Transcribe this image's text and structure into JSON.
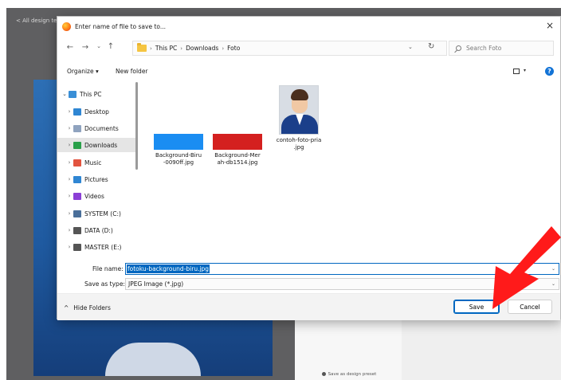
{
  "background": {
    "back_link": "< All design te",
    "preset_label": "Save as design preset"
  },
  "dialog": {
    "title": "Enter name of file to save to...",
    "close_glyph": "×",
    "nav": {
      "back_glyph": "←",
      "forward_glyph": "→",
      "recent_glyph": "⌄",
      "up_glyph": "↑",
      "breadcrumb": [
        "This PC",
        "Downloads",
        "Foto"
      ],
      "crumb_separator": "›",
      "address_dropdown_glyph": "⌄",
      "refresh_glyph": "↻",
      "search_placeholder": "Search Foto"
    },
    "commands": {
      "organize_label": "Organize ▾",
      "new_folder_label": "New folder",
      "view_dropdown_glyph": "▾",
      "help_glyph": "?"
    },
    "tree": [
      {
        "label": "This PC",
        "chevron": "⌄",
        "color": "#3a8fd6"
      },
      {
        "label": "Desktop",
        "chevron": "›",
        "color": "#2f86d3"
      },
      {
        "label": "Documents",
        "chevron": "›",
        "color": "#8fa3bf"
      },
      {
        "label": "Downloads",
        "chevron": "›",
        "color": "#2aa04a"
      },
      {
        "label": "Music",
        "chevron": "›",
        "color": "#e2543f"
      },
      {
        "label": "Pictures",
        "chevron": "›",
        "color": "#2f86d3"
      },
      {
        "label": "Videos",
        "chevron": "›",
        "color": "#8b3fd6"
      },
      {
        "label": "SYSTEM (C:)",
        "chevron": "›",
        "color": "#4a6f9a"
      },
      {
        "label": "DATA (D:)",
        "chevron": "›",
        "color": "#555555"
      },
      {
        "label": "MASTER (E:)",
        "chevron": "›",
        "color": "#555555"
      }
    ],
    "files": [
      {
        "name": "Background-Biru-0090ff.jpg",
        "line1": "Background-Biru",
        "line2": "-0090ff.jpg",
        "thumb_color": "#1a8df2"
      },
      {
        "name": "Background-Merah-db1514.jpg",
        "line1": "Background-Mer",
        "line2": "ah-db1514.jpg",
        "thumb_color": "#d4201f"
      },
      {
        "name": "contoh-foto-pria.jpg",
        "line1": "contoh-foto-pria",
        "line2": ".jpg"
      }
    ],
    "file_name_label": "File name:",
    "file_name_value": "fotoku-background-biru.jpg",
    "save_type_label": "Save as type:",
    "save_type_value": "JPEG Image (*.jpg)",
    "select_chevron": "⌄",
    "hide_folders_label": "Hide Folders",
    "hide_folders_glyph": "^",
    "save_label": "Save",
    "cancel_label": "Cancel"
  },
  "colors": {
    "accent": "#0067c0",
    "annotation_arrow": "#ff1a1a"
  }
}
